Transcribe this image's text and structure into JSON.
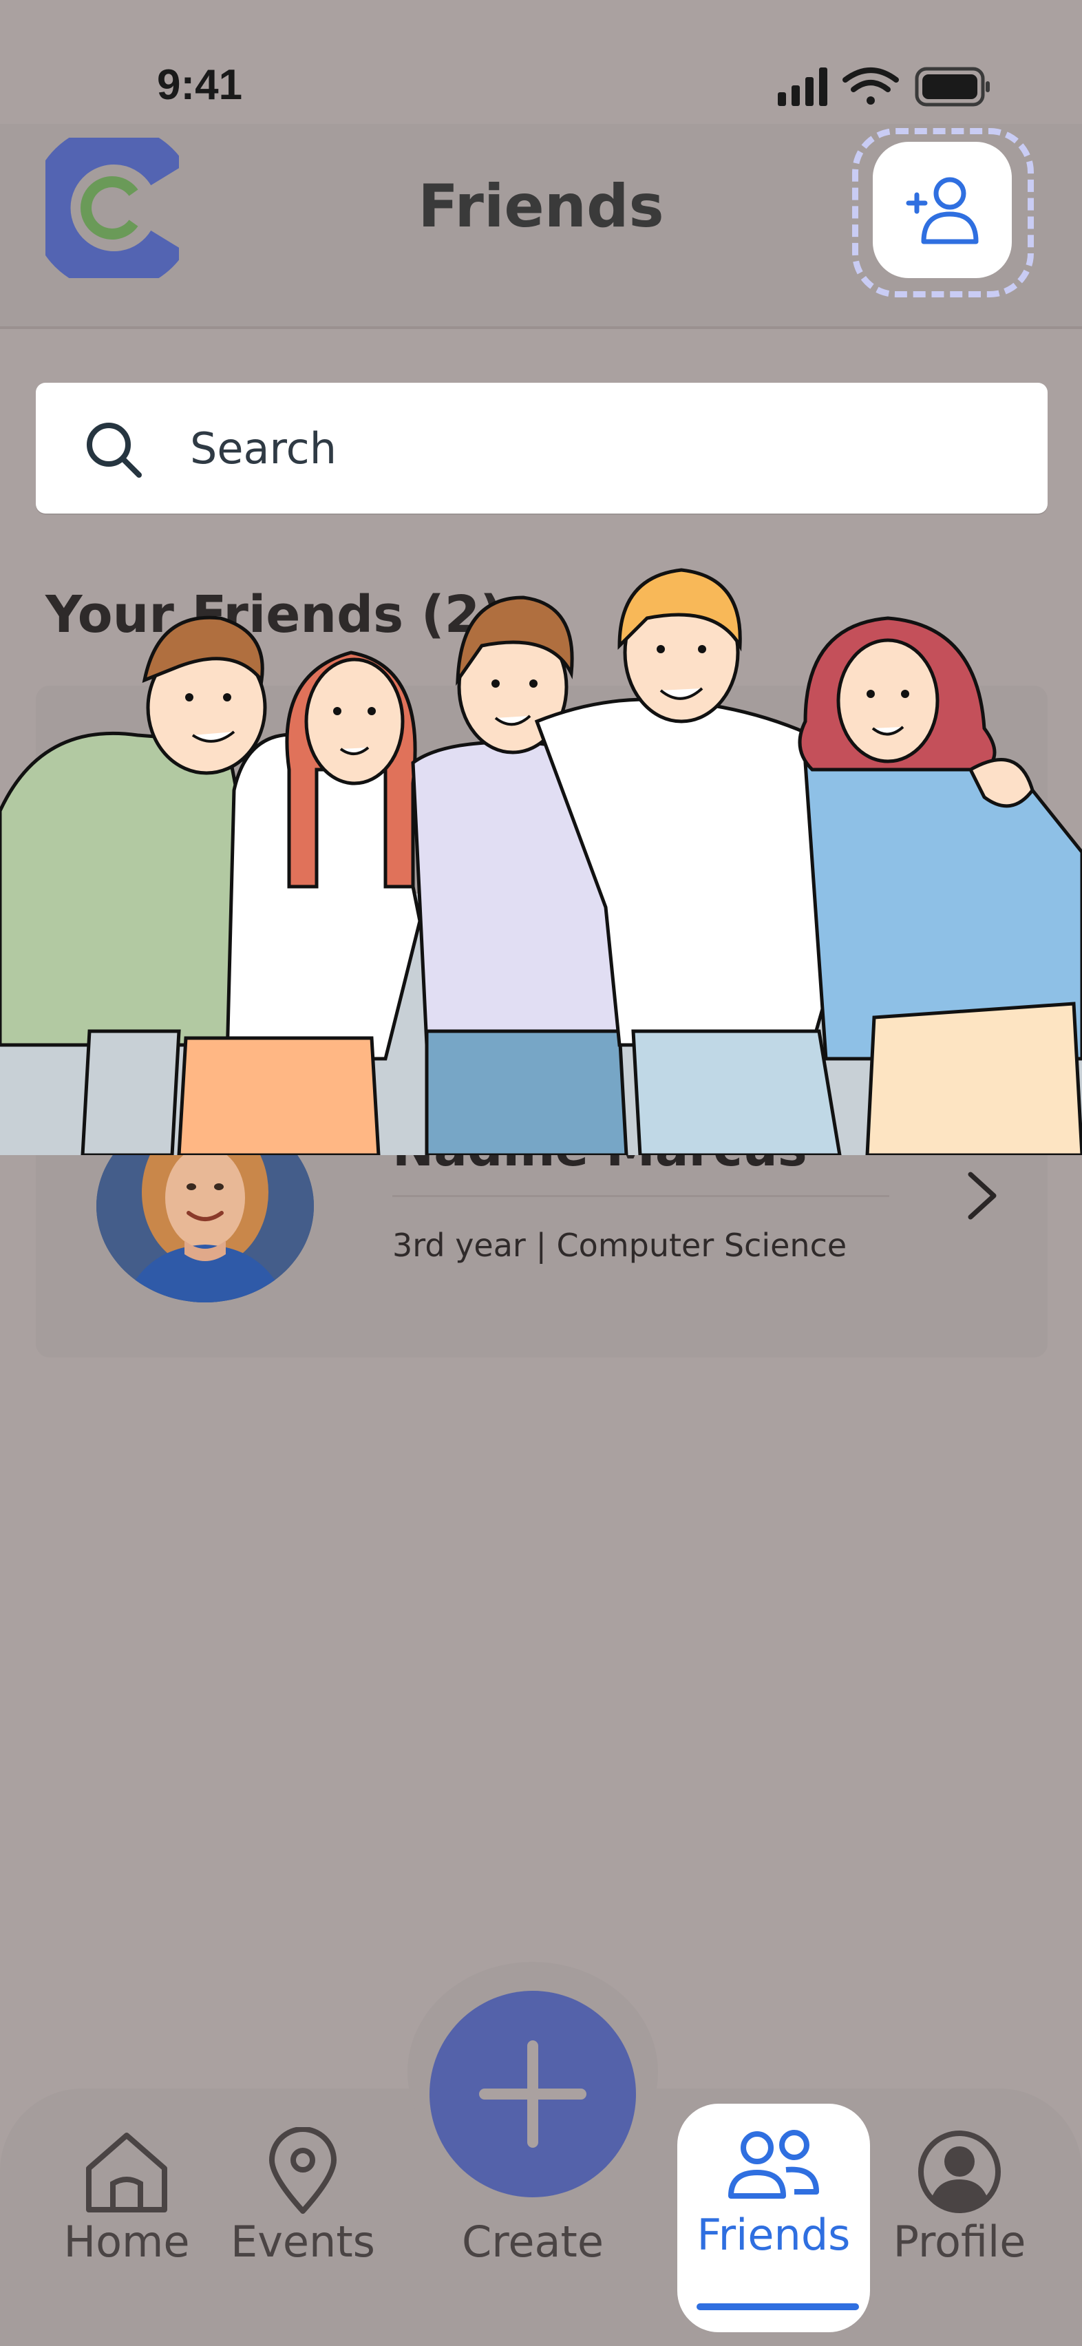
{
  "status_bar": {
    "time": "9:41"
  },
  "header": {
    "title": "Friends"
  },
  "search": {
    "placeholder": "Search"
  },
  "friends_section": {
    "title": "Your Friends (2)",
    "friends": [
      {
        "name": "Nadine Marcus",
        "details": "3rd year | Computer Science"
      }
    ]
  },
  "tab_bar": {
    "create_label": "Create",
    "tabs": [
      {
        "label": "Home"
      },
      {
        "label": "Events"
      },
      {
        "label": "Friends"
      },
      {
        "label": "Profile"
      }
    ]
  },
  "colors": {
    "accent": "#2f6fe0",
    "fab": "#5462aa",
    "logo_blue": "#5364b2",
    "logo_green": "#6a9a58"
  }
}
